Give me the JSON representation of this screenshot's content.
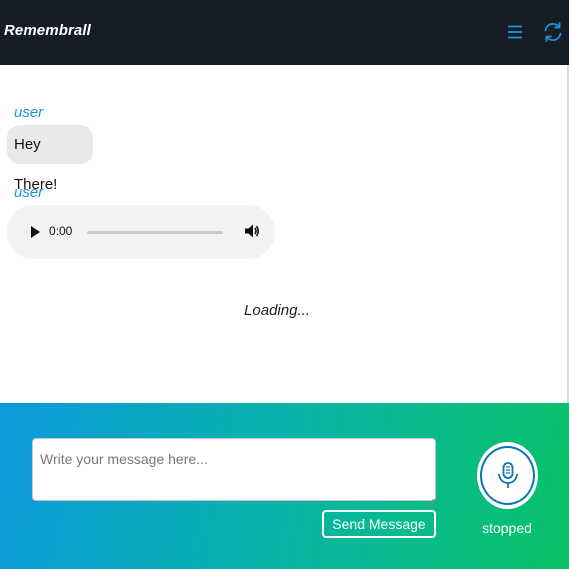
{
  "app": {
    "title": "Remembrall"
  },
  "header": {
    "menu_icon": "hamburger-menu-icon",
    "refresh_icon": "refresh-icon"
  },
  "messages": [
    {
      "sender": "user",
      "type": "text",
      "text": "Hey There!"
    },
    {
      "sender": "user",
      "type": "audio",
      "time": "0:00"
    }
  ],
  "loading_text": "Loading...",
  "composer": {
    "placeholder": "Write your message here...",
    "value": "",
    "send_label": "Send Message",
    "mic_icon": "microphone-icon",
    "recording_status": "stopped"
  },
  "colors": {
    "header_bg": "#161d26",
    "accent": "#1b94d8",
    "gradient_start": "#0c9adc",
    "gradient_end": "#07c266"
  }
}
